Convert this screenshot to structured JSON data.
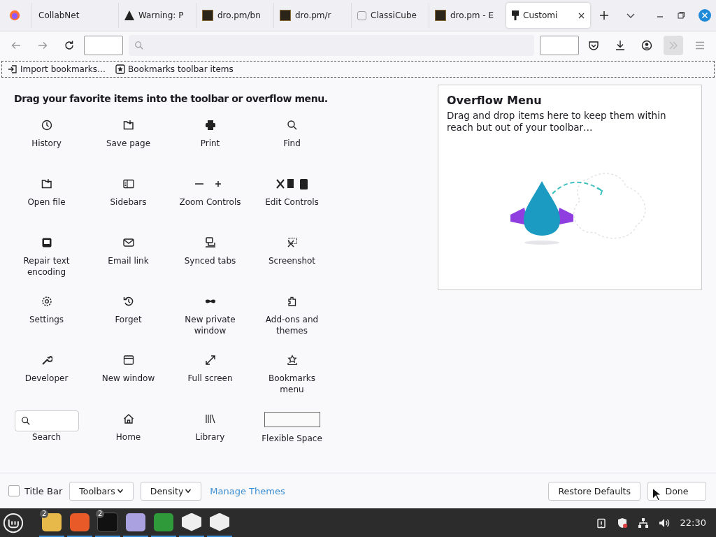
{
  "tabs": [
    {
      "label": "CollabNet",
      "selected": false
    },
    {
      "label": "Warning: P",
      "selected": false
    },
    {
      "label": "dro.pm/bn",
      "selected": false
    },
    {
      "label": "dro.pm/r",
      "selected": false
    },
    {
      "label": "ClassiCube",
      "selected": false
    },
    {
      "label": "dro.pm - E",
      "selected": false
    },
    {
      "label": "Customi",
      "selected": true
    }
  ],
  "bookmarks_toolbar": [
    {
      "label": "Import bookmarks…"
    },
    {
      "label": "Bookmarks toolbar items"
    }
  ],
  "palette": {
    "heading": "Drag your favorite items into the toolbar or overflow menu.",
    "items": [
      {
        "label": "History",
        "kind": "button"
      },
      {
        "label": "Save page",
        "kind": "button"
      },
      {
        "label": "Print",
        "kind": "button"
      },
      {
        "label": "Find",
        "kind": "button"
      },
      {
        "label": "Open file",
        "kind": "button"
      },
      {
        "label": "Sidebars",
        "kind": "button"
      },
      {
        "label": "Zoom Controls",
        "kind": "button"
      },
      {
        "label": "Edit Controls",
        "kind": "button"
      },
      {
        "label": "Repair text encoding",
        "kind": "button"
      },
      {
        "label": "Email link",
        "kind": "button"
      },
      {
        "label": "Synced tabs",
        "kind": "button"
      },
      {
        "label": "Screenshot",
        "kind": "button"
      },
      {
        "label": "Settings",
        "kind": "button"
      },
      {
        "label": "Forget",
        "kind": "button"
      },
      {
        "label": "New private window",
        "kind": "button"
      },
      {
        "label": "Add-ons and themes",
        "kind": "button"
      },
      {
        "label": "Developer",
        "kind": "button"
      },
      {
        "label": "New window",
        "kind": "button"
      },
      {
        "label": "Full screen",
        "kind": "button"
      },
      {
        "label": "Bookmarks menu",
        "kind": "button"
      },
      {
        "label": "Search",
        "kind": "search"
      },
      {
        "label": "Home",
        "kind": "button"
      },
      {
        "label": "Library",
        "kind": "button"
      },
      {
        "label": "Flexible Space",
        "kind": "spacer"
      }
    ]
  },
  "overflow_panel": {
    "title": "Overflow Menu",
    "description": "Drag and drop items here to keep them within reach but out of your toolbar…"
  },
  "footer": {
    "title_bar": {
      "label": "Title Bar",
      "checked": false
    },
    "toolbars": "Toolbars",
    "density": "Density",
    "manage_themes": "Manage Themes",
    "restore_defaults": "Restore Defaults",
    "done": "Done"
  },
  "taskbar": {
    "apps": [
      {
        "badge": "2",
        "active": true
      },
      {
        "active": true
      },
      {
        "badge": "2",
        "active": true
      },
      {
        "active": true
      },
      {
        "active": true
      },
      {
        "active": true
      },
      {
        "active": true
      }
    ],
    "clock": "22:30"
  }
}
